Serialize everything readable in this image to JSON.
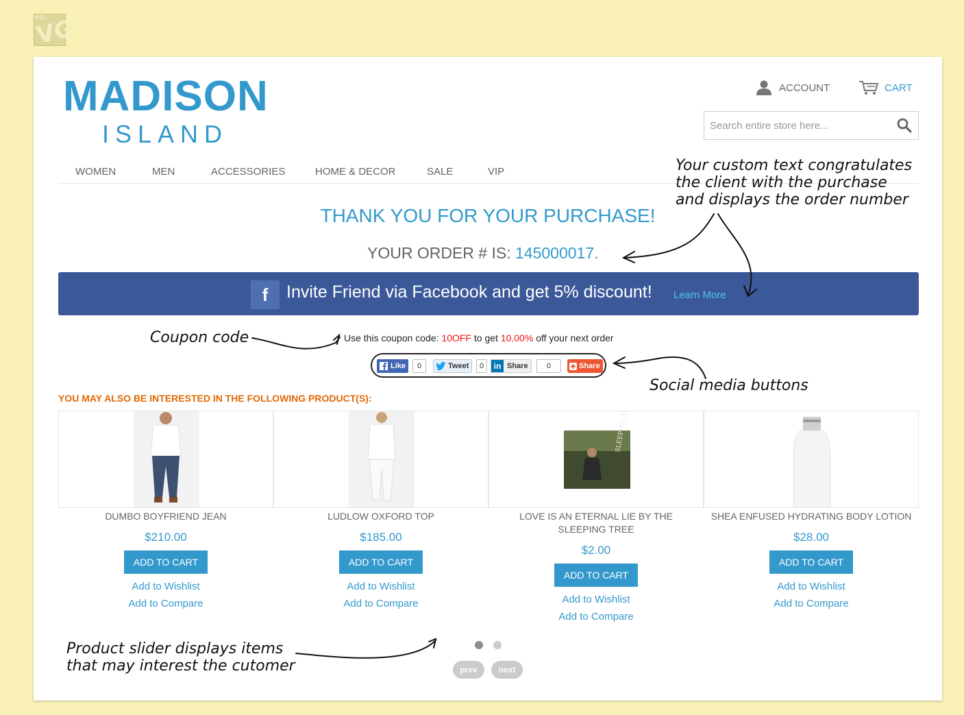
{
  "header": {
    "logo_main": "MADISON",
    "logo_sub": "ISLAND",
    "account_label": "ACCOUNT",
    "cart_label": "CART",
    "search_placeholder": "Search entire store here..."
  },
  "nav": {
    "items": [
      "WOMEN",
      "MEN",
      "ACCESSORIES",
      "HOME & DECOR",
      "SALE",
      "VIP"
    ]
  },
  "success": {
    "thank_you": "THANK YOU FOR YOUR PURCHASE!",
    "order_prefix": "YOUR ORDER # IS:",
    "order_number": "145000017",
    "order_suffix": "."
  },
  "facebook_banner": {
    "icon_letter": "f",
    "text": "Invite Friend via Facebook and get 5% discount!",
    "learn_more": "Learn More"
  },
  "coupon": {
    "prefix": "Use this coupon code:",
    "code": "10OFF",
    "middle": "to get",
    "discount": "10.00%",
    "suffix": "off your next order"
  },
  "social": {
    "like_label": "Like",
    "like_count": "0",
    "tweet_label": "Tweet",
    "tweet_count": "0",
    "linkedin_logo": "in",
    "linkedin_label": "Share",
    "linkedin_count": "0",
    "share_label": "Share"
  },
  "related": {
    "title": "YOU MAY ALSO BE INTERESTED IN THE FOLLOWING PRODUCT(S):",
    "products": [
      {
        "name": "DUMBO BOYFRIEND JEAN",
        "price": "$210.00",
        "add_to_cart": "ADD TO CART",
        "wishlist": "Add to Wishlist",
        "compare": "Add to Compare"
      },
      {
        "name": "LUDLOW OXFORD TOP",
        "price": "$185.00",
        "add_to_cart": "ADD TO CART",
        "wishlist": "Add to Wishlist",
        "compare": "Add to Compare"
      },
      {
        "name": "LOVE IS AN ETERNAL LIE BY THE SLEEPING TREE",
        "price": "$2.00",
        "add_to_cart": "ADD TO CART",
        "wishlist": "Add to Wishlist",
        "compare": "Add to Compare"
      },
      {
        "name": "SHEA ENFUSED HYDRATING BODY LOTION",
        "price": "$28.00",
        "add_to_cart": "ADD TO CART",
        "wishlist": "Add to Wishlist",
        "compare": "Add to Compare"
      }
    ],
    "album_art_text": "SLEEPING TREE",
    "prev_label": "prev",
    "next_label": "next"
  },
  "annotations": {
    "custom_text": [
      "Your custom text congratulates",
      "the client with the purchase",
      "and displays the order number"
    ],
    "coupon_code": "Coupon code",
    "social_buttons": "Social media buttons",
    "slider": [
      "Product slider displays items",
      "that may interest the cutomer"
    ]
  },
  "corner_logo": {
    "small_text": "BEL",
    "big_text": "VG"
  },
  "colors": {
    "accent": "#3399cc",
    "facebook_blue": "#3b5998",
    "section_title_orange": "#e26703",
    "coupon_red": "#ee1111",
    "background_yellow": "#f9f0b6"
  },
  "icons": {
    "account": "user-icon",
    "cart": "cart-icon",
    "search": "search-icon",
    "facebook": "facebook-icon"
  }
}
